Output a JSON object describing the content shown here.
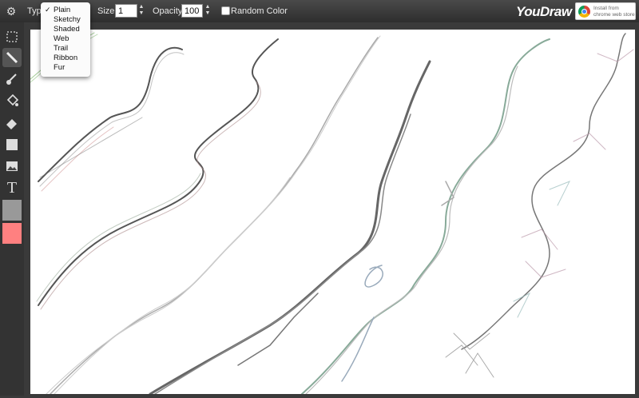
{
  "toolbar": {
    "type_label": "Type",
    "size_label": "Size:",
    "size_value": "1",
    "opacity_label": "Opacity:",
    "opacity_value": "100",
    "random_color_label": "Random Color",
    "random_color_checked": false
  },
  "brand": {
    "logo": "YouDraw",
    "install_text": "Install from chrome web store"
  },
  "type_menu": {
    "selected": "Plain",
    "options": [
      "Plain",
      "Sketchy",
      "Shaded",
      "Web",
      "Trail",
      "Ribbon",
      "Fur"
    ]
  },
  "tools": [
    "selection-icon",
    "pencil-icon",
    "brush-icon",
    "fill-bucket-icon",
    "eraser-icon",
    "rectangle-icon",
    "image-icon",
    "text-icon"
  ],
  "colors": {
    "primary": "#999999",
    "secondary": "#ff8080"
  }
}
